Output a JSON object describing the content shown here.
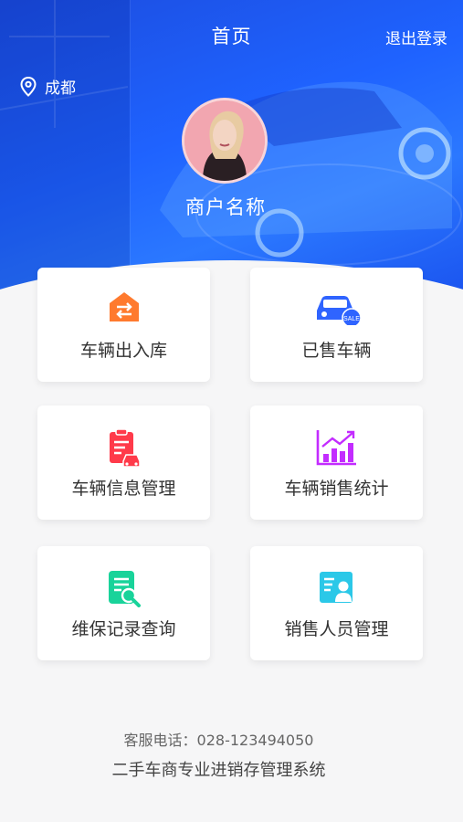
{
  "header": {
    "title": "首页",
    "logout_label": "退出登录",
    "city": "成都",
    "merchant_name": "商户名称"
  },
  "menu": [
    {
      "label": "车辆出入库",
      "icon": "warehouse-transfer-icon",
      "color": "#ff7a2e"
    },
    {
      "label": "已售车辆",
      "icon": "sold-car-icon",
      "color": "#2f64ff"
    },
    {
      "label": "车辆信息管理",
      "icon": "vehicle-info-icon",
      "color": "#ff3a4a"
    },
    {
      "label": "车辆销售统计",
      "icon": "sales-chart-icon",
      "color": "#c32cff"
    },
    {
      "label": "维保记录查询",
      "icon": "maintenance-search-icon",
      "color": "#19d39a"
    },
    {
      "label": "销售人员管理",
      "icon": "salesperson-icon",
      "color": "#2bc8e8"
    }
  ],
  "footer": {
    "hotline": "客服电话：028-123494050",
    "system_name": "二手车商专业进销存管理系统"
  },
  "colors": {
    "hero_blue": "#1f63ff",
    "background": "#f6f6f7",
    "card": "#ffffff"
  }
}
